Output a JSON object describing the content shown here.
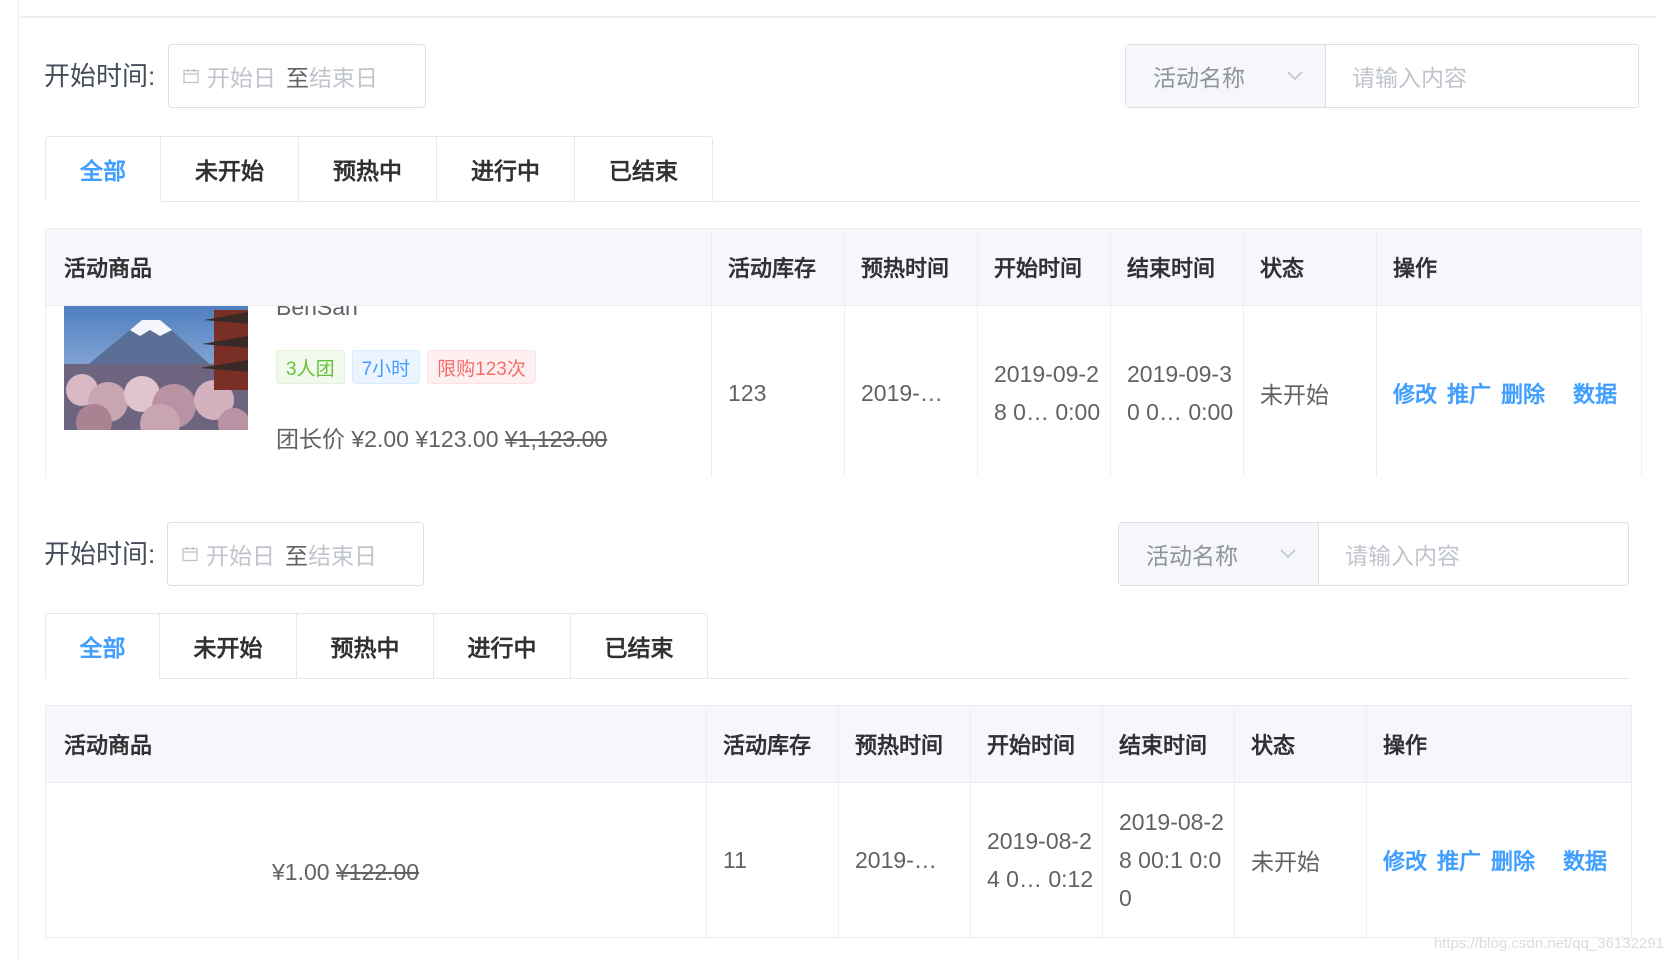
{
  "colors": {
    "accent": "#409eff",
    "tag_green": "#67c23a",
    "tag_blue": "#409eff",
    "tag_red": "#f56c6c",
    "header_bg": "#f5f7fa"
  },
  "filter": {
    "start_label": "开始时间:",
    "start_placeholder": "开始日",
    "range_separator": "至",
    "end_placeholder": "结束日",
    "search_type": "活动名称",
    "search_placeholder": "请输入内容"
  },
  "tabs": [
    "全部",
    "未开始",
    "预热中",
    "进行中",
    "已结束"
  ],
  "active_tab": "全部",
  "columns": [
    "活动商品",
    "活动库存",
    "预热时间",
    "开始时间",
    "结束时间",
    "状态",
    "操作"
  ],
  "actions": [
    "修改",
    "推广",
    "删除",
    "数据"
  ],
  "panel1": {
    "row": {
      "product_name": "BenSan",
      "thumbnail": "mountain-cherry-blossom-image",
      "tags": [
        "3人团",
        "7小时",
        "限购123次"
      ],
      "price_prefix": "团长价",
      "price_leader": "¥2.00",
      "price_group": "¥123.00",
      "price_original": "¥1,123.00",
      "stock": "123",
      "preheat_time": "2019-…",
      "start_time": "2019-09-28 0… 0:00",
      "end_time": "2019-09-30 0… 0:00",
      "status": "未开始"
    }
  },
  "panel2": {
    "row": {
      "price_group": "¥1.00",
      "price_original": "¥122.00",
      "stock": "11",
      "preheat_time": "2019-…",
      "start_time": "2019-08-24 0… 0:12",
      "end_time": "2019-08-28 00:1 0:00",
      "status": "未开始"
    }
  },
  "watermark": "https://blog.csdn.net/qq_36132291"
}
